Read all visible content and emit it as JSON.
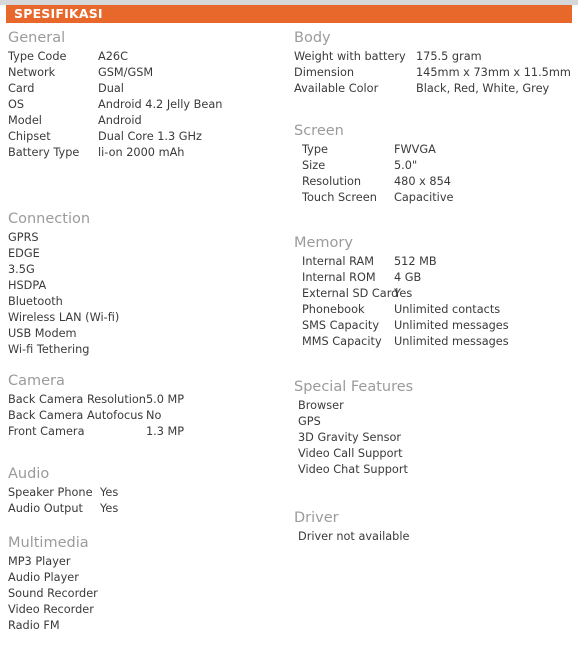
{
  "header": {
    "title": "SPESIFIKASI",
    "bar_color": "#e8682c",
    "strip_color": "#d6d7d9",
    "title_color": "#ffffff"
  },
  "theme": {
    "section_heading_color": "#9b9b9b",
    "body_text_color": "#3a3a3a",
    "background": "#ffffff"
  },
  "left_column": {
    "sections": [
      {
        "title": "General",
        "rows": [
          {
            "label": "Type Code",
            "value": "A26C"
          },
          {
            "label": "Network",
            "value": "GSM/GSM"
          },
          {
            "label": "Card",
            "value": "Dual"
          },
          {
            "label": "OS",
            "value": "Android 4.2 Jelly Bean"
          },
          {
            "label": "Model",
            "value": "Android"
          },
          {
            "label": "Chipset",
            "value": "Dual Core 1.3 GHz"
          },
          {
            "label": "Battery Type",
            "value": "li-on 2000 mAh"
          }
        ]
      },
      {
        "title": "Connection",
        "rows": [
          {
            "label": "GPRS"
          },
          {
            "label": "EDGE"
          },
          {
            "label": "3.5G"
          },
          {
            "label": "HSDPA"
          },
          {
            "label": "Bluetooth"
          },
          {
            "label": "Wireless LAN (Wi-fi)"
          },
          {
            "label": "USB Modem"
          },
          {
            "label": "Wi-fi Tethering"
          }
        ]
      },
      {
        "title": "Camera",
        "rows": [
          {
            "label": "Back Camera Resolution",
            "value": "5.0 MP"
          },
          {
            "label": "Back Camera Autofocus",
            "value": "No"
          },
          {
            "label": "Front Camera",
            "value": "1.3 MP"
          }
        ]
      },
      {
        "title": "Audio",
        "rows": [
          {
            "label": "Speaker Phone",
            "value": "Yes"
          },
          {
            "label": "Audio Output",
            "value": "Yes"
          }
        ]
      },
      {
        "title": "Multimedia",
        "rows": [
          {
            "label": "MP3 Player"
          },
          {
            "label": "Audio Player"
          },
          {
            "label": "Sound Recorder"
          },
          {
            "label": "Video Recorder"
          },
          {
            "label": "Radio FM"
          }
        ]
      }
    ]
  },
  "right_column": {
    "sections": [
      {
        "title": "Body",
        "rows": [
          {
            "label": "Weight with battery",
            "value": "175.5 gram"
          },
          {
            "label": "Dimension",
            "value": "145mm x 73mm x 11.5mm"
          },
          {
            "label": "Available Color",
            "value": "Black, Red, White, Grey"
          }
        ]
      },
      {
        "title": "Screen",
        "rows": [
          {
            "label": "Type",
            "value": "FWVGA"
          },
          {
            "label": "Size",
            "value": "5.0\""
          },
          {
            "label": "Resolution",
            "value": "480 x 854"
          },
          {
            "label": "Touch Screen",
            "value": "Capacitive"
          }
        ]
      },
      {
        "title": "Memory",
        "rows": [
          {
            "label": "Internal RAM",
            "value": "512 MB"
          },
          {
            "label": "Internal ROM",
            "value": "4 GB"
          },
          {
            "label": "External SD Card",
            "value": "Yes"
          },
          {
            "label": "Phonebook",
            "value": "Unlimited contacts"
          },
          {
            "label": "SMS Capacity",
            "value": "Unlimited messages"
          },
          {
            "label": "MMS Capacity",
            "value": "Unlimited messages"
          }
        ]
      },
      {
        "title": "Special Features",
        "rows": [
          {
            "label": "Browser"
          },
          {
            "label": "GPS"
          },
          {
            "label": "3D Gravity Sensor"
          },
          {
            "label": "Video Call Support"
          },
          {
            "label": "Video Chat Support"
          }
        ]
      },
      {
        "title": "Driver",
        "rows": [
          {
            "label": "Driver not available"
          }
        ]
      }
    ]
  }
}
